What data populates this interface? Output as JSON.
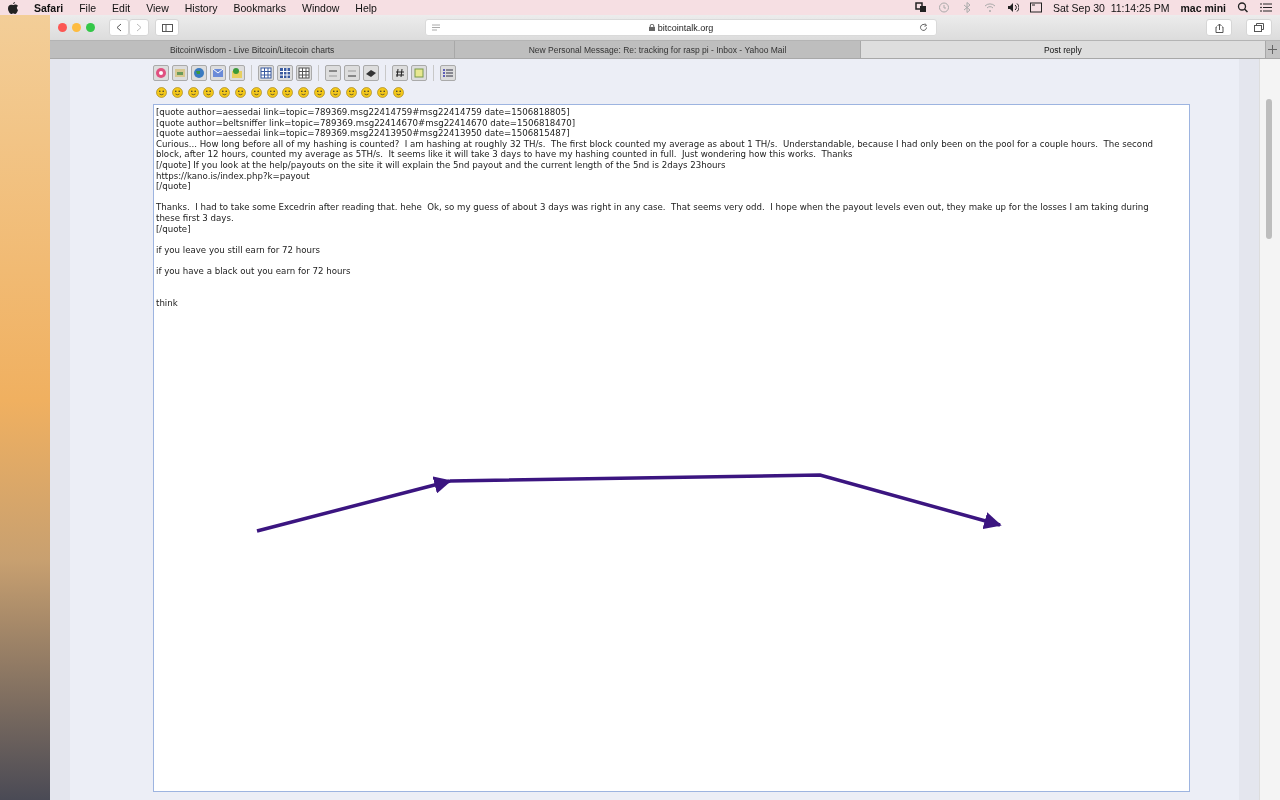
{
  "menu_bar": {
    "app": "Safari",
    "items": [
      "File",
      "Edit",
      "View",
      "History",
      "Bookmarks",
      "Window",
      "Help"
    ],
    "clock": "Sat Sep 30  11:14:25 PM",
    "user": "mac mini"
  },
  "browser": {
    "address": "bitcointalk.org",
    "tabs": [
      {
        "label": "BitcoinWisdom - Live Bitcoin/Litecoin charts",
        "selected": false
      },
      {
        "label": "New Personal Message: Re: tracking for rasp pi - Inbox - Yahoo Mail",
        "selected": false
      },
      {
        "label": "Post reply",
        "selected": true
      }
    ]
  },
  "editor": {
    "text": "[quote author=aessedai link=topic=789369.msg22414759#msg22414759 date=1506818805]\n[quote author=beltsniffer link=topic=789369.msg22414670#msg22414670 date=1506818470]\n[quote author=aessedai link=topic=789369.msg22413950#msg22413950 date=1506815487]\nCurious... How long before all of my hashing is counted?  I am hashing at roughly 32 TH/s.  The first block counted my average as about 1 TH/s.  Understandable, because I had only been on the pool for a couple hours.  The second\nblock, after 12 hours, counted my average as 5TH/s.  It seems like it will take 3 days to have my hashing counted in full.  Just wondering how this works.  Thanks\n[/quote] If you look at the help/payouts on the site it will explain the 5nd payout and the current length of the 5nd is 2days 23hours\nhttps://kano.is/index.php?k=payout\n[/quote]\n\nThanks.  I had to take some Excedrin after reading that. hehe  Ok, so my guess of about 3 days was right in any case.  That seems very odd.  I hope when the payout levels even out, they make up for the losses I am taking during\nthese first 3 days.\n[/quote]\n\nif you leave you still earn for 72 hours\n\nif you have a black out you earn for 72 hours\n\n\nthink"
  }
}
